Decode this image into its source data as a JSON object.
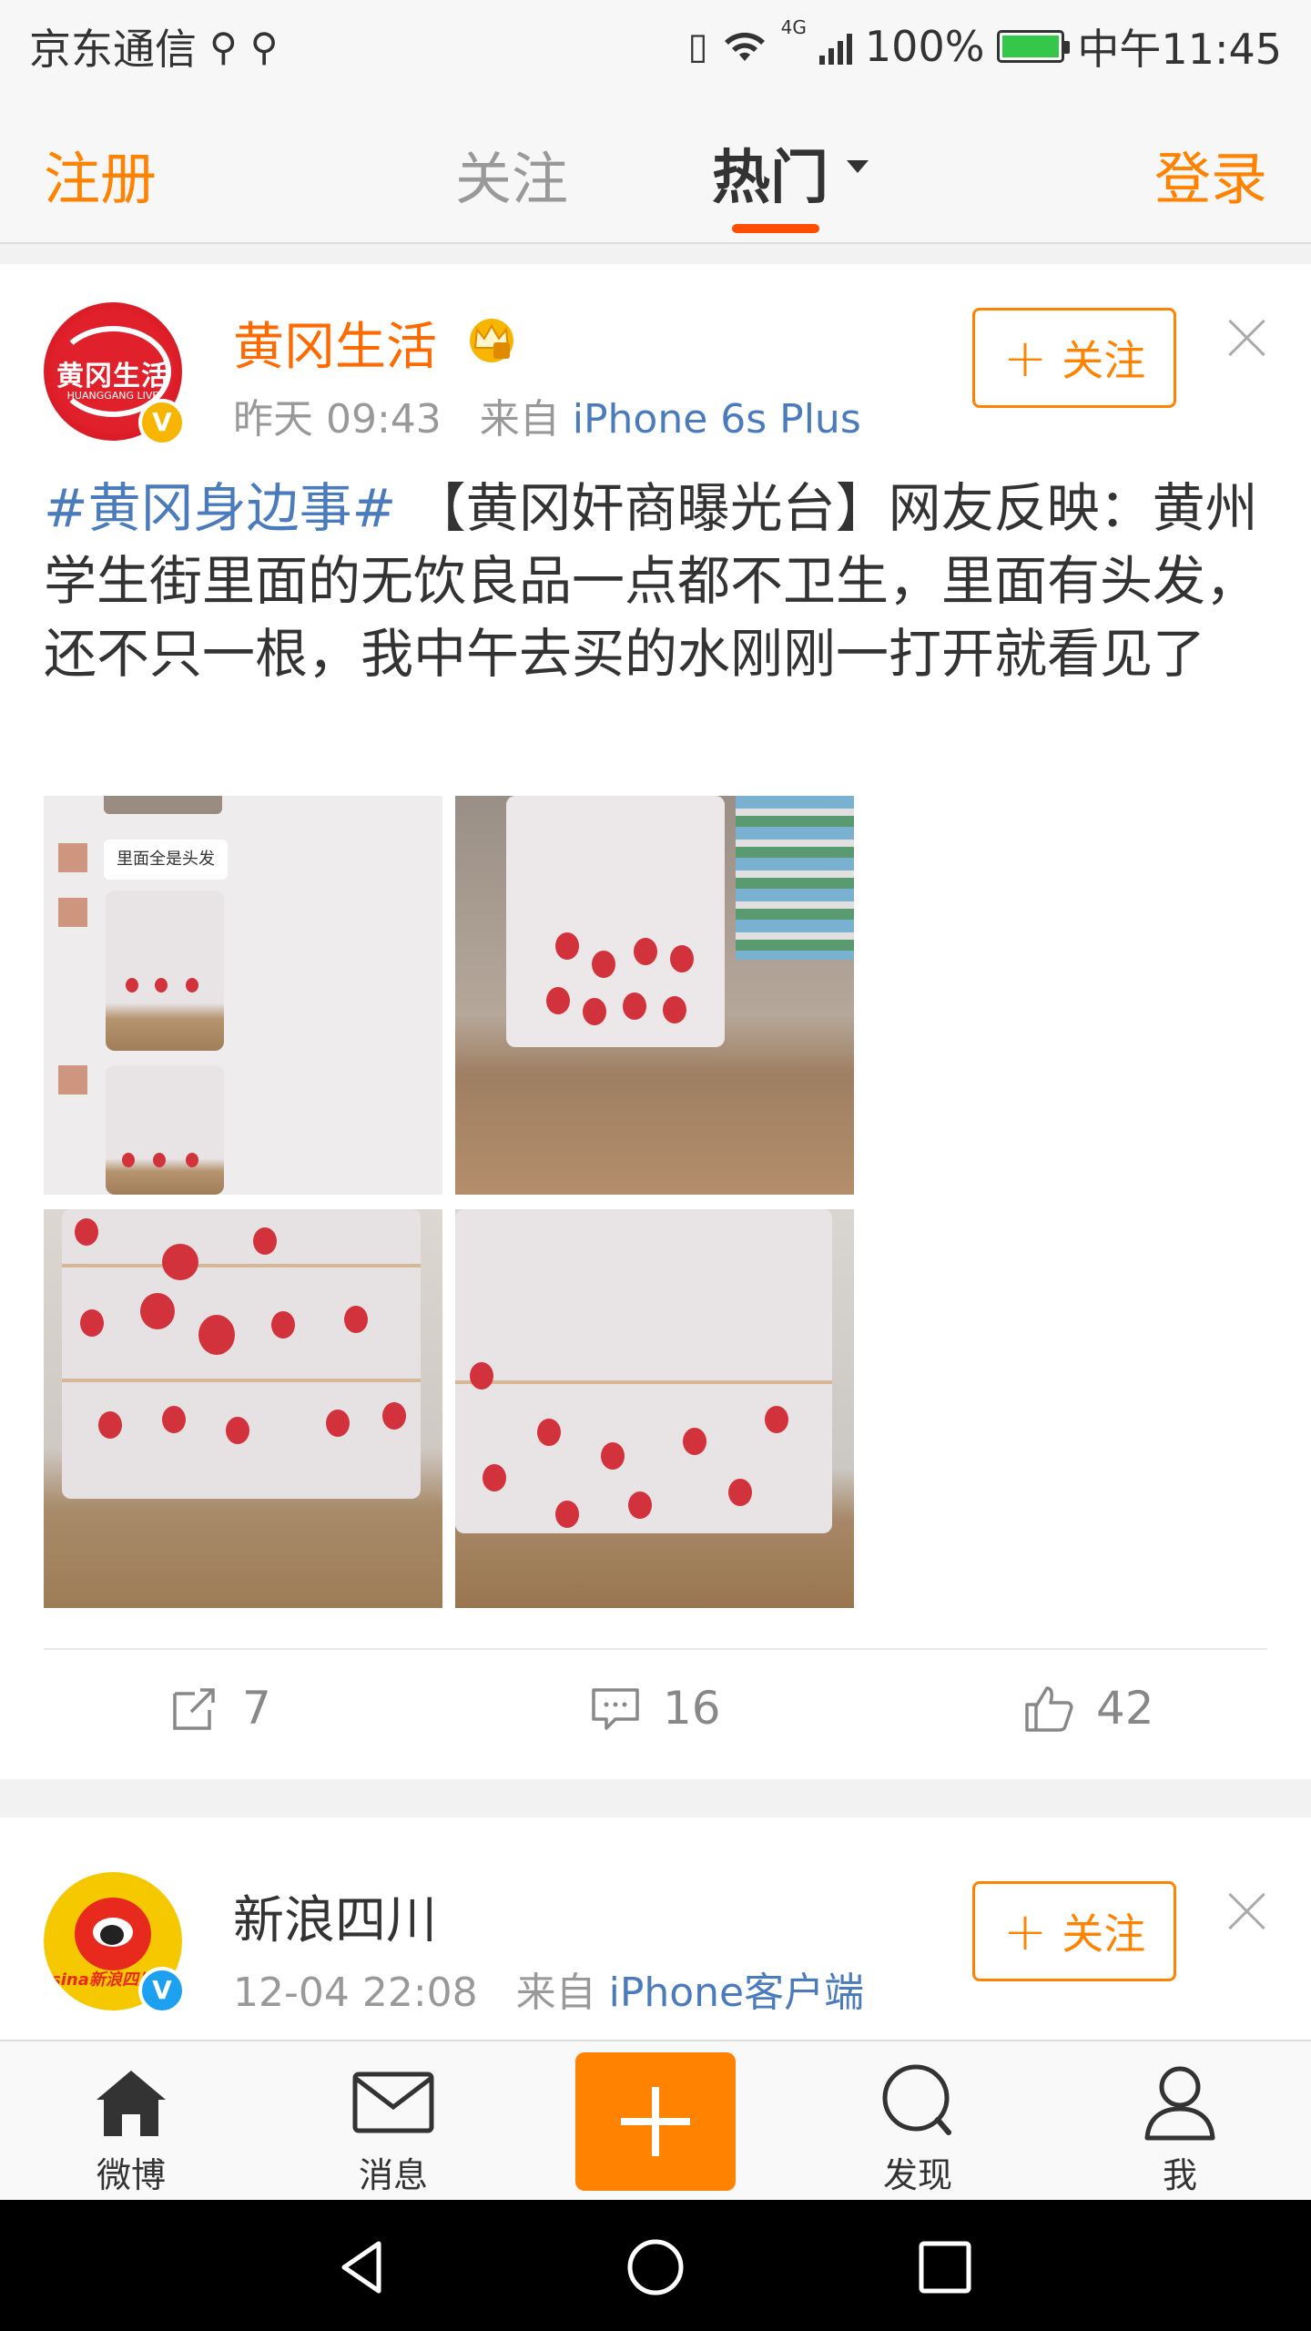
{
  "status_bar": {
    "carrier": "京东通信",
    "network": "4G",
    "battery": "100%",
    "time": "中午11:45"
  },
  "top_nav": {
    "register": "注册",
    "follow": "关注",
    "hot": "热门",
    "login": "登录"
  },
  "posts": [
    {
      "author": "黄冈生活",
      "avatar_text": "黄冈生活",
      "avatar_subtext": "HUANGGANG LIVE",
      "time": "昨天 09:43",
      "from_label": "来自",
      "source": "iPhone 6s Plus",
      "follow_label": "关注",
      "hashtag": "#黄冈身边事#",
      "text": " 【黄冈奸商曝光台】网友反映：黄州学生街里面的无饮良品一点都不卫生，里面有头发，还不只一根，我中午去买的水刚刚一打开就看见了",
      "image_caption": "里面全是头发",
      "reposts": "7",
      "comments": "16",
      "likes": "42"
    },
    {
      "author": "新浪四川",
      "avatar_logo": "sina新浪四川",
      "time": "12-04 22:08",
      "from_label": "来自",
      "source": "iPhone客户端",
      "follow_label": "关注"
    }
  ],
  "tab_bar": {
    "home": "微博",
    "messages": "消息",
    "discover": "发现",
    "me": "我"
  },
  "colors": {
    "accent": "#ff8200",
    "link": "#4a7bbd",
    "indicator": "#ff4e00"
  }
}
